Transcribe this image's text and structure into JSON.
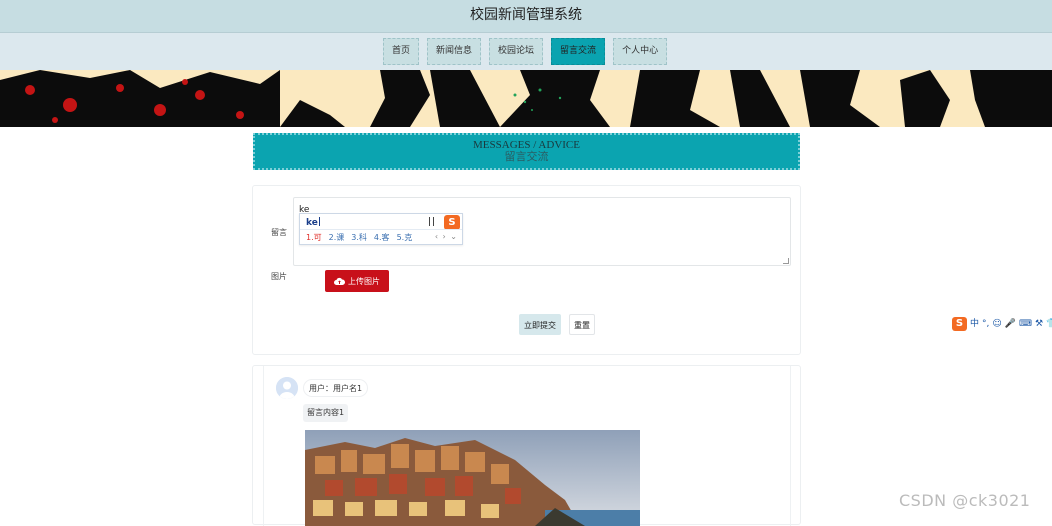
{
  "header": {
    "title": "校园新闻管理系统"
  },
  "nav": {
    "items": [
      {
        "label": "首页",
        "active": false
      },
      {
        "label": "新闻信息",
        "active": false
      },
      {
        "label": "校园论坛",
        "active": false
      },
      {
        "label": "留言交流",
        "active": true
      },
      {
        "label": "个人中心",
        "active": false
      }
    ]
  },
  "section": {
    "title_en": "MESSAGES / ADVICE",
    "title_cn": "留言交流"
  },
  "form": {
    "message_label": "留言",
    "message_value": "ke",
    "image_label": "图片",
    "upload_label": "上传图片",
    "submit_label": "立即提交",
    "reset_label": "重置"
  },
  "ime_popup": {
    "composition": "ke",
    "candidates": [
      "1.可",
      "2.课",
      "3.科",
      "4.客",
      "5.克"
    ],
    "pager": "‹ › ⌄"
  },
  "ime_toolbar": {
    "lang": "中"
  },
  "message": {
    "user": "用户：用户名1",
    "content": "留言内容1"
  },
  "watermark": "CSDN @ck3021",
  "colors": {
    "accent": "#0aa3b0",
    "upload": "#c8101a",
    "topbar": "#c6dde2",
    "ime": "#f36a22"
  }
}
